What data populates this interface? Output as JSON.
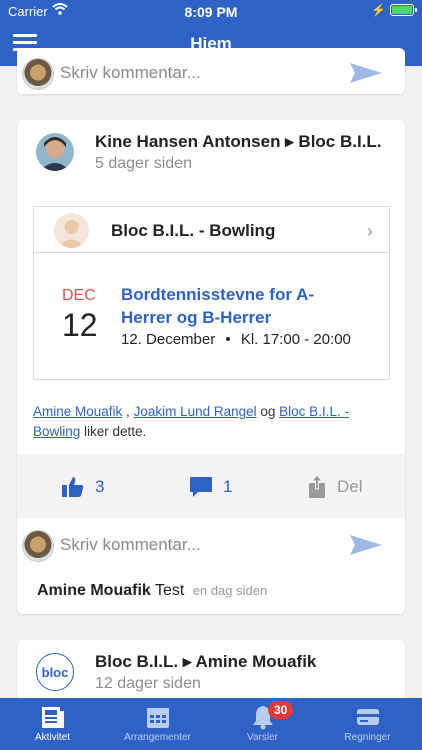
{
  "status_bar": {
    "carrier": "Carrier",
    "time": "8:09 PM"
  },
  "header": {
    "title": "Hjem"
  },
  "top_comment": {
    "placeholder": "Skriv kommentar..."
  },
  "post1": {
    "author": "Kine Hansen Antonsen ▸ Bloc B.I.L.",
    "time": "5 dager siden",
    "event": {
      "group": "Bloc B.I.L. - Bowling",
      "month": "DEC",
      "day": "12",
      "title": "Bordtennisstevne for A-Herrer og B-Herrer",
      "date": "12. December",
      "separator": "•",
      "time": "Kl. 17:00 - 20:00"
    },
    "likes": {
      "user1": "Amine Mouafik",
      "sep1": " , ",
      "user2": "Joakim Lund Rangel",
      "sep2": " og ",
      "user3": "Bloc B.I.L. - Bowling",
      "suffix": " liker dette."
    },
    "actions": {
      "likes_count": "3",
      "comments_count": "1",
      "share_label": "Del"
    },
    "comment_placeholder": "Skriv kommentar...",
    "comment": {
      "author": "Amine Mouafik",
      "text": "Test",
      "time": "en dag siden"
    }
  },
  "post2": {
    "logo_text": "bloc",
    "author": "Bloc B.I.L. ▸ Amine Mouafik",
    "time": "12 dager siden"
  },
  "tabbar": {
    "tabs": [
      {
        "label": "Aktivitet"
      },
      {
        "label": "Arrangementer"
      },
      {
        "label": "Varsler"
      },
      {
        "label": "Regninger"
      }
    ],
    "notification_badge": "30"
  },
  "colors": {
    "brand": "#2f62c6",
    "date_red": "#d9534f",
    "badge_red": "#e53935"
  }
}
